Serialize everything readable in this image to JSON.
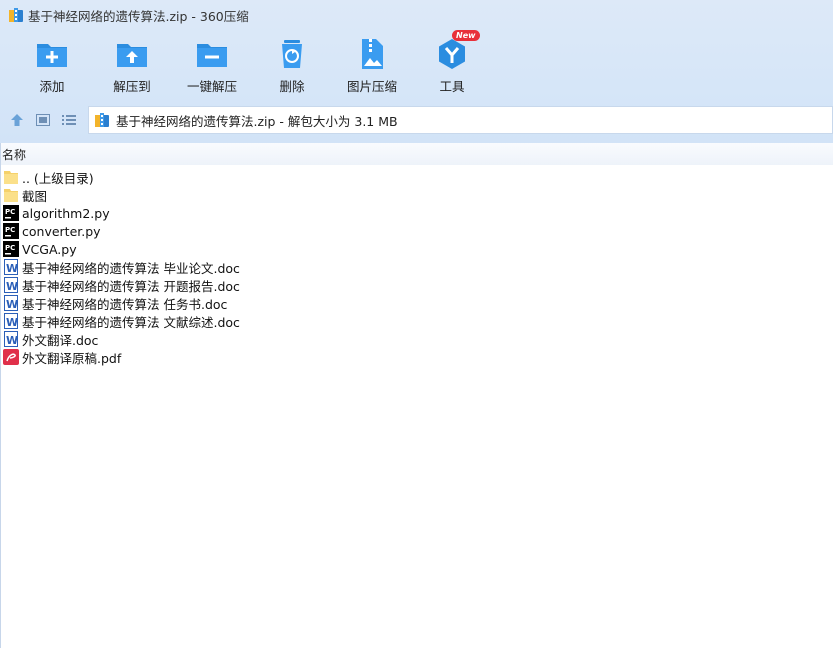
{
  "window": {
    "title": "基于神经网络的遗传算法.zip - 360压缩"
  },
  "toolbar": {
    "buttons": [
      {
        "label": "添加",
        "icon": "add-folder-icon"
      },
      {
        "label": "解压到",
        "icon": "extract-to-icon"
      },
      {
        "label": "一键解压",
        "icon": "one-click-extract-icon"
      },
      {
        "label": "删除",
        "icon": "delete-icon"
      },
      {
        "label": "图片压缩",
        "icon": "image-compress-icon"
      },
      {
        "label": "工具",
        "icon": "tools-icon",
        "badge": "New"
      }
    ]
  },
  "navbar": {
    "path": "基于神经网络的遗传算法.zip - 解包大小为 3.1 MB"
  },
  "list": {
    "column_name": "名称",
    "items": [
      {
        "name": ".. (上级目录)",
        "type": "folder"
      },
      {
        "name": "截图",
        "type": "folder"
      },
      {
        "name": "algorithm2.py",
        "type": "py"
      },
      {
        "name": "converter.py",
        "type": "py"
      },
      {
        "name": "VCGA.py",
        "type": "py"
      },
      {
        "name": "基于神经网络的遗传算法 毕业论文.doc",
        "type": "doc"
      },
      {
        "name": "基于神经网络的遗传算法 开题报告.doc",
        "type": "doc"
      },
      {
        "name": "基于神经网络的遗传算法 任务书.doc",
        "type": "doc"
      },
      {
        "name": "基于神经网络的遗传算法 文献综述.doc",
        "type": "doc"
      },
      {
        "name": "外文翻译.doc",
        "type": "doc"
      },
      {
        "name": "外文翻译原稿.pdf",
        "type": "pdf"
      }
    ]
  },
  "colors": {
    "accent": "#2b8de0",
    "badge": "#e8303a"
  }
}
